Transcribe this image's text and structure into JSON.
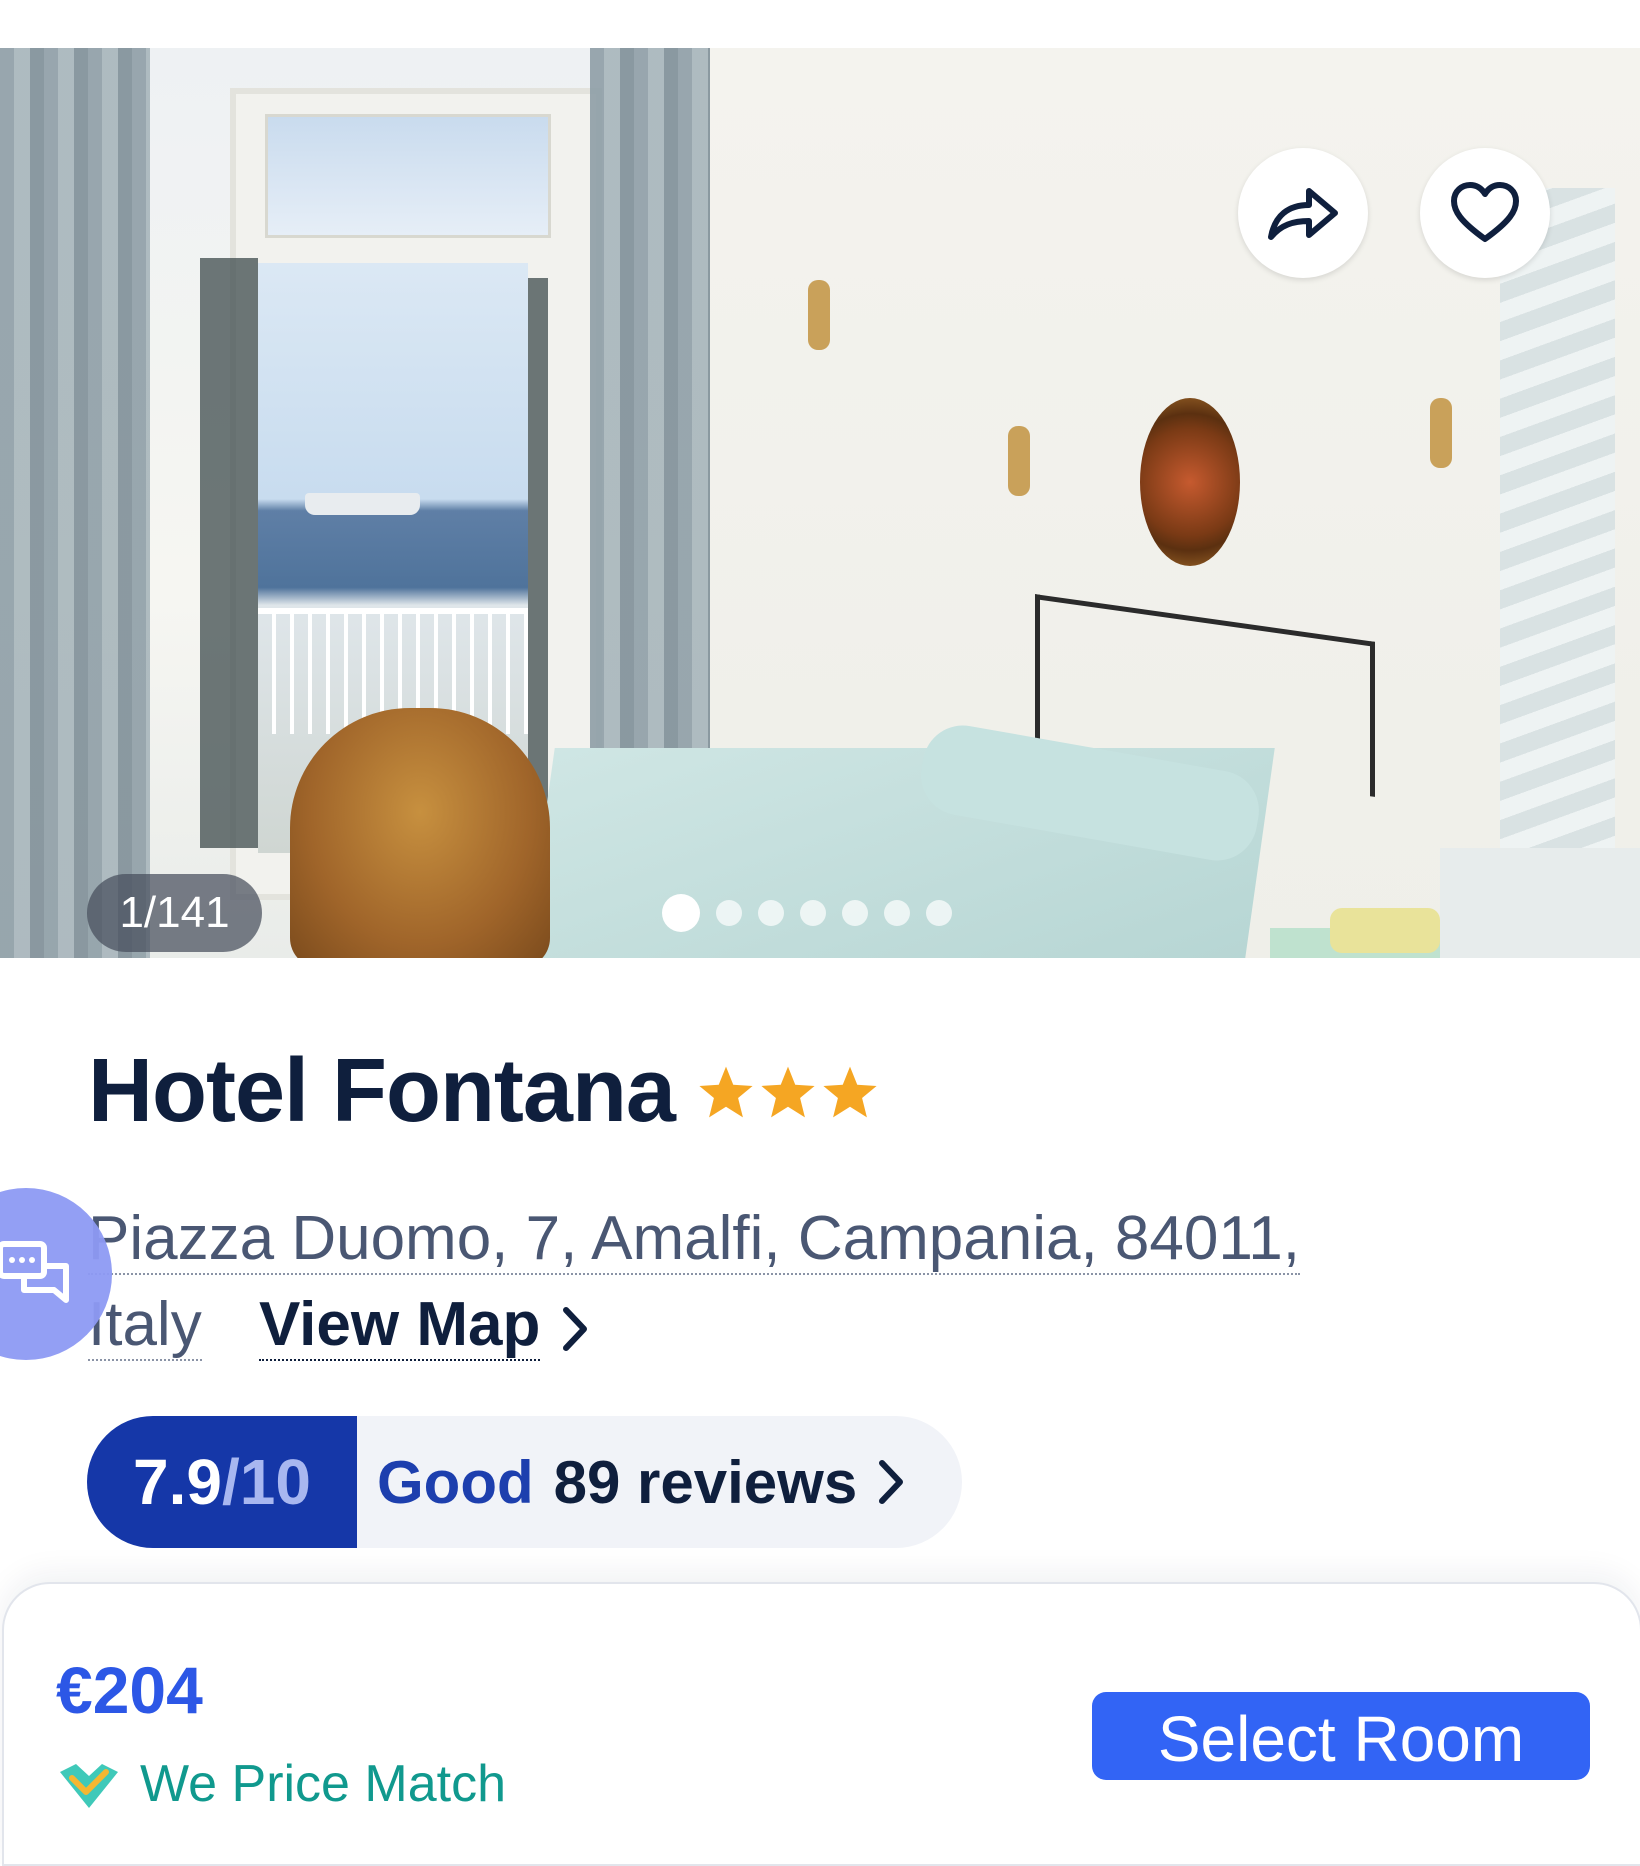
{
  "gallery": {
    "counter": "1/141",
    "dot_count": 7,
    "active_dot": 0,
    "share_icon": "share-icon",
    "favorite_icon": "heart-icon"
  },
  "hotel": {
    "name": "Hotel Fontana",
    "star_rating": 3,
    "star_color": "#f5a623",
    "address": "Piazza Duomo, 7, Amalfi, Campania, 84011, Italy",
    "view_map_label": "View Map"
  },
  "rating": {
    "score": "7.9",
    "out_of": "/10",
    "label": "Good",
    "reviews": "89 reviews"
  },
  "booking": {
    "price": "€204",
    "price_match": "We Price Match",
    "select_room_label": "Select Room"
  },
  "colors": {
    "brand_blue": "#3264f5",
    "score_badge": "#1537a8",
    "price_match_teal": "#10998e"
  }
}
